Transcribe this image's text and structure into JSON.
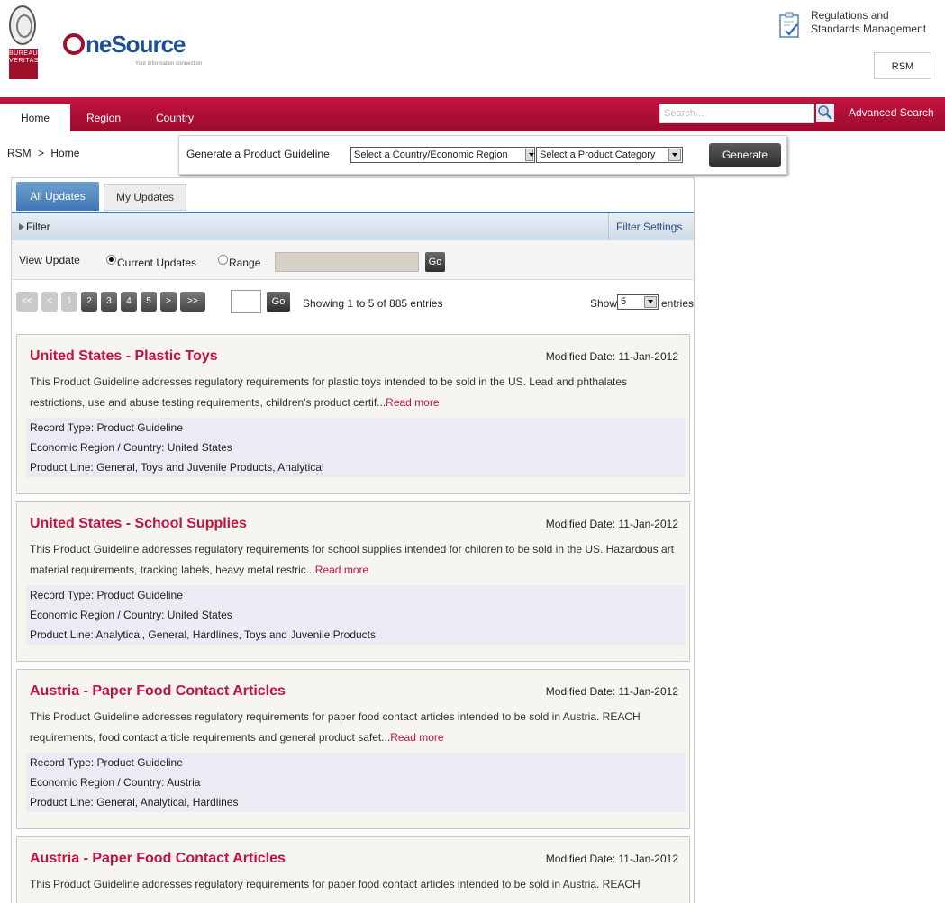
{
  "header": {
    "bv_lines": [
      "BUREAU",
      "VERITAS"
    ],
    "logo": {
      "one": "ne",
      "source": "Source",
      "tagline": "Your information connection"
    },
    "rsm": {
      "title_line1": "Regulations and",
      "title_line2": "Standards Management",
      "box_label": "RSM"
    }
  },
  "nav": {
    "items": [
      "Home",
      "Region",
      "Country"
    ],
    "search_placeholder": "Search...",
    "advanced_search": "Advanced Search"
  },
  "breadcrumb": {
    "root": "RSM",
    "sep": ">",
    "current": "Home"
  },
  "generate": {
    "label": "Generate a Product Guideline",
    "country_select": "Select a Country/Economic Region",
    "category_select": "Select a Product Category",
    "button": "Generate"
  },
  "tabs": {
    "all": "All Updates",
    "my": "My Updates"
  },
  "filter": {
    "label": "Filter",
    "settings": "Filter Settings"
  },
  "view_update": {
    "label": "View Update",
    "current": "Current Updates",
    "range": "Range",
    "go": "Go"
  },
  "pager": {
    "first": "<<",
    "prev": "<",
    "pages": [
      "1",
      "2",
      "3",
      "4",
      "5"
    ],
    "next": ">",
    "last": ">>",
    "go": "Go",
    "showing": "Showing 1 to 5 of 885 entries",
    "show_label": "Show",
    "show_value": "5",
    "entries_label": "entries"
  },
  "records": [
    {
      "title": "United States - Plastic Toys",
      "modified": "Modified Date: 11-Jan-2012",
      "desc": "This Product Guideline addresses regulatory requirements for plastic toys intended to be sold in the US. Lead and phthalates restrictions, use and abuse testing requirements, children's product certif...",
      "read_more": "Read more",
      "record_type_label": "Record Type:",
      "record_type": "Product Guideline",
      "region_label": "Economic Region / Country:",
      "region": "United States",
      "line_label": "Product Line:",
      "line": "General, Toys and Juvenile Products, Analytical"
    },
    {
      "title": "United States - School Supplies",
      "modified": "Modified Date: 11-Jan-2012",
      "desc": "This Product Guideline addresses regulatory requirements for school supplies intended for children to be sold in the US. Hazardous art material requirements, tracking labels, heavy metal restric...",
      "read_more": "Read more",
      "record_type_label": "Record Type:",
      "record_type": "Product Guideline",
      "region_label": "Economic Region / Country:",
      "region": "United States",
      "line_label": "Product Line:",
      "line": "Analytical, General, Hardlines, Toys and Juvenile Products"
    },
    {
      "title": "Austria - Paper Food Contact Articles",
      "modified": "Modified Date: 11-Jan-2012",
      "desc": "This Product Guideline addresses regulatory requirements for paper food contact articles intended to be sold in Austria. REACH requirements, food contact article requirements and general product safet...",
      "read_more": "Read more",
      "record_type_label": "Record Type:",
      "record_type": "Product Guideline",
      "region_label": "Economic Region / Country:",
      "region": "Austria",
      "line_label": "Product Line:",
      "line": "General, Analytical, Hardlines"
    },
    {
      "title": "Austria - Paper Food Contact Articles",
      "modified": "Modified Date: 11-Jan-2012",
      "desc": "This Product Guideline addresses regulatory requirements for paper food contact articles intended to be sold in Austria. REACH",
      "read_more": "",
      "record_type_label": "",
      "record_type": "",
      "region_label": "",
      "region": "",
      "line_label": "",
      "line": ""
    }
  ],
  "colors": {
    "brand_red": "#c4123f",
    "link_blue": "#1d4f95",
    "tab_blue": "#3f77b4"
  }
}
